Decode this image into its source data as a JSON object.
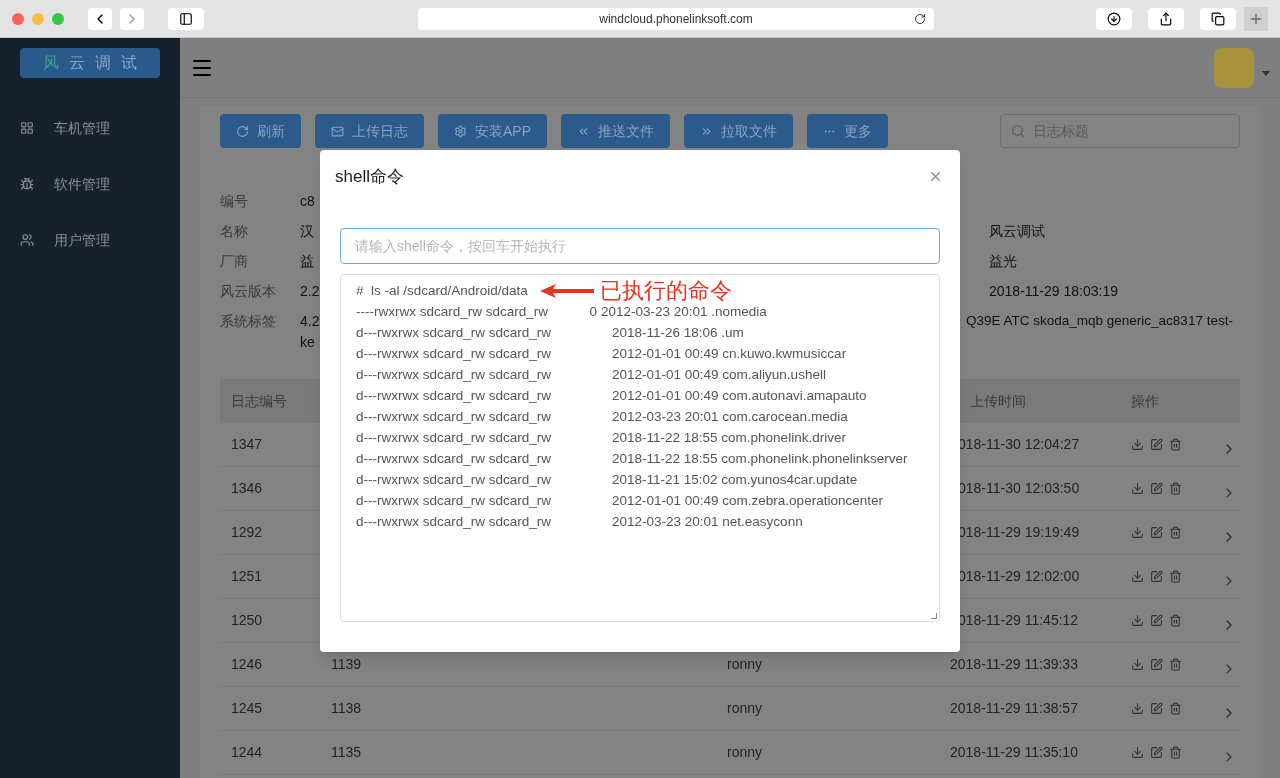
{
  "browser": {
    "url": "windcloud.phonelinksoft.com"
  },
  "sidebar": {
    "logo": [
      "风",
      "云",
      "调",
      "试"
    ],
    "items": [
      {
        "kind": "grid",
        "label": "车机管理"
      },
      {
        "kind": "bug",
        "label": "软件管理"
      },
      {
        "kind": "users",
        "label": "用户管理"
      }
    ]
  },
  "toolbar": {
    "buttons": [
      {
        "kind": "refresh",
        "label": "刷新"
      },
      {
        "kind": "mail",
        "label": "上传日志"
      },
      {
        "kind": "gear",
        "label": "安装APP"
      },
      {
        "kind": "push",
        "label": "推送文件"
      },
      {
        "kind": "pull",
        "label": "拉取文件"
      },
      {
        "kind": "more",
        "label": "更多"
      }
    ],
    "search": {
      "placeholder": "日志标题"
    }
  },
  "info": {
    "rows": [
      {
        "label": "编号",
        "value": "c8"
      },
      {
        "label": "名称",
        "value": "汉",
        "right": "风云调试"
      },
      {
        "label": "厂商",
        "value": "益",
        "right": "益光"
      },
      {
        "label": "风云版本",
        "value": "2.2",
        "right": "2018-11-29 18:03:19"
      },
      {
        "label": "系统标签",
        "value": "4.2",
        "value_2": "ke",
        "right": "Q39E ATC skoda_mqb generic_ac8317 test-"
      }
    ]
  },
  "table": {
    "columns": [
      "日志编号",
      "上传时间",
      "操作"
    ],
    "rows": [
      {
        "id": "1347",
        "time": "018-11-30 12:04:27"
      },
      {
        "id": "1346",
        "time": "018-11-30 12:03:50"
      },
      {
        "id": "1292",
        "time": "018-11-29 19:19:49"
      },
      {
        "id": "1251",
        "time": "018-11-29 12:02:00"
      },
      {
        "id": "1250",
        "time": "018-11-29 11:45:12"
      },
      {
        "id": "1246",
        "column_2": "1139",
        "column_3": "ronny",
        "time": "2018-11-29 11:39:33"
      },
      {
        "id": "1245",
        "column_2": "1138",
        "column_3": "ronny",
        "time": "2018-11-29 11:38:57"
      },
      {
        "id": "1244",
        "column_2": "1135",
        "column_3": "ronny",
        "time": "2018-11-29 11:35:10"
      }
    ]
  },
  "modal": {
    "title": "shell命令",
    "input": {
      "placeholder": "请输入shell命令，按回车开始执行"
    },
    "command": "#  ls -al /sdcard/Android/data",
    "annotation": "已执行的命令",
    "output": [
      {
        "perms": "----rwxrwx sdcard_rw sdcard_rw",
        "size": "0",
        "rest": "2012-03-23 20:01 .nomedia"
      },
      {
        "perms": "d---rwxrwx sdcard_rw sdcard_rw",
        "rest": "2018-11-26 18:06 .um"
      },
      {
        "perms": "d---rwxrwx sdcard_rw sdcard_rw",
        "rest": "2012-01-01 00:49 cn.kuwo.kwmusiccar"
      },
      {
        "perms": "d---rwxrwx sdcard_rw sdcard_rw",
        "rest": "2012-01-01 00:49 com.aliyun.ushell"
      },
      {
        "perms": "d---rwxrwx sdcard_rw sdcard_rw",
        "rest": "2012-01-01 00:49 com.autonavi.amapauto"
      },
      {
        "perms": "d---rwxrwx sdcard_rw sdcard_rw",
        "rest": "2012-03-23 20:01 com.carocean.media"
      },
      {
        "perms": "d---rwxrwx sdcard_rw sdcard_rw",
        "rest": "2018-11-22 18:55 com.phonelink.driver"
      },
      {
        "perms": "d---rwxrwx sdcard_rw sdcard_rw",
        "rest": "2018-11-22 18:55 com.phonelink.phonelinkserver"
      },
      {
        "perms": "d---rwxrwx sdcard_rw sdcard_rw",
        "rest": "2018-11-21 15:02 com.yunos4car.update"
      },
      {
        "perms": "d---rwxrwx sdcard_rw sdcard_rw",
        "rest": "2012-01-01 00:49 com.zebra.operationcenter"
      },
      {
        "perms": "d---rwxrwx sdcard_rw sdcard_rw",
        "rest": "2012-03-23 20:01 net.easyconn"
      }
    ]
  }
}
